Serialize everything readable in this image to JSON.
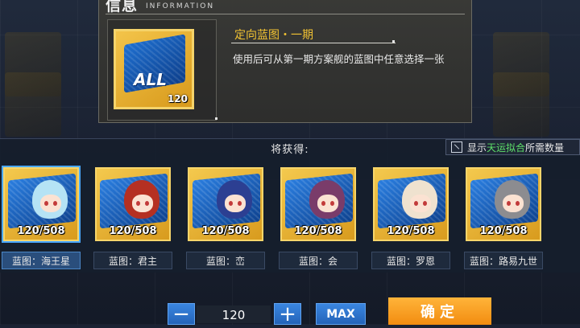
{
  "info": {
    "title": "信息",
    "subtitle": "INFORMATION",
    "item_name": "定向蓝图・一期",
    "description": "使用后可从第一期方案舰的蓝图中任意选择一张",
    "icon_text": "ALL",
    "icon_qty": "120"
  },
  "rewards": {
    "label": "将获得:",
    "toggle_prefix": "显示",
    "toggle_highlight": "天运拟合",
    "toggle_suffix": "所需数量",
    "items": [
      {
        "count": "120/508",
        "label": "蓝图：海王星",
        "hair": "#b5e3f5",
        "selected": true
      },
      {
        "count": "120/508",
        "label": "蓝图：君主",
        "hair": "#b53022",
        "selected": false
      },
      {
        "count": "120/508",
        "label": "蓝图：峦",
        "hair": "#2c3f92",
        "selected": false
      },
      {
        "count": "120/508",
        "label": "蓝图：会",
        "hair": "#7a3c6a",
        "selected": false
      },
      {
        "count": "120/508",
        "label": "蓝图：罗恩",
        "hair": "#efe2cf",
        "selected": false
      },
      {
        "count": "120/508",
        "label": "蓝图：路易九世",
        "hair": "#8c8c90",
        "selected": false
      }
    ]
  },
  "controls": {
    "minus": "−",
    "quantity": "120",
    "plus": "+",
    "max": "MAX",
    "confirm": "确定"
  },
  "colors": {
    "accent_gold": "#f1c232",
    "button_blue": "#2f78d4",
    "confirm_orange": "#f7a028",
    "highlight_green": "#5ee06a"
  }
}
